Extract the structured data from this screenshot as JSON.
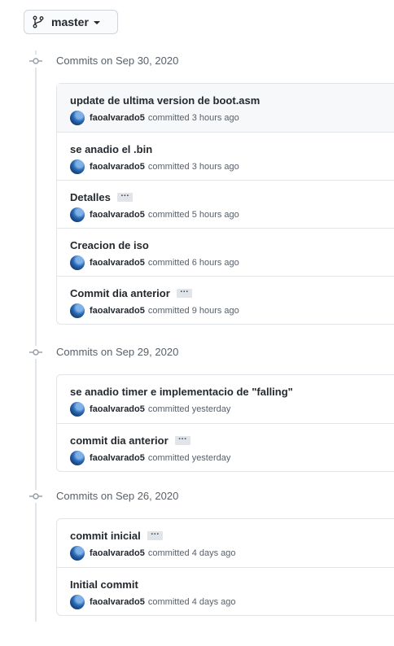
{
  "branch": {
    "name": "master",
    "icon": "git-branch-icon"
  },
  "groups": [
    {
      "title": "Commits on Sep 30, 2020",
      "commits": [
        {
          "message": "update de ultima version de boot.asm",
          "author": "faoalvarado5",
          "verb": "committed",
          "time": "3 hours ago",
          "more": false
        },
        {
          "message": "se anadio el .bin",
          "author": "faoalvarado5",
          "verb": "committed",
          "time": "3 hours ago",
          "more": false
        },
        {
          "message": "Detalles",
          "author": "faoalvarado5",
          "verb": "committed",
          "time": "5 hours ago",
          "more": true
        },
        {
          "message": "Creacion de iso",
          "author": "faoalvarado5",
          "verb": "committed",
          "time": "6 hours ago",
          "more": false
        },
        {
          "message": "Commit dia anterior",
          "author": "faoalvarado5",
          "verb": "committed",
          "time": "9 hours ago",
          "more": true
        }
      ]
    },
    {
      "title": "Commits on Sep 29, 2020",
      "commits": [
        {
          "message": "se anadio timer e implementacio de \"falling\"",
          "author": "faoalvarado5",
          "verb": "committed",
          "time": "yesterday",
          "more": false
        },
        {
          "message": "commit dia anterior",
          "author": "faoalvarado5",
          "verb": "committed",
          "time": "yesterday",
          "more": true
        }
      ]
    },
    {
      "title": "Commits on Sep 26, 2020",
      "commits": [
        {
          "message": "commit inicial",
          "author": "faoalvarado5",
          "verb": "committed",
          "time": "4 days ago",
          "more": true
        },
        {
          "message": "Initial commit",
          "author": "faoalvarado5",
          "verb": "committed",
          "time": "4 days ago",
          "more": false
        }
      ]
    }
  ],
  "ellipsis_text": "…",
  "colors": {
    "border": "#e1e4e8",
    "muted": "#586069",
    "text": "#24292e",
    "highlight": "#f6f8fa"
  }
}
